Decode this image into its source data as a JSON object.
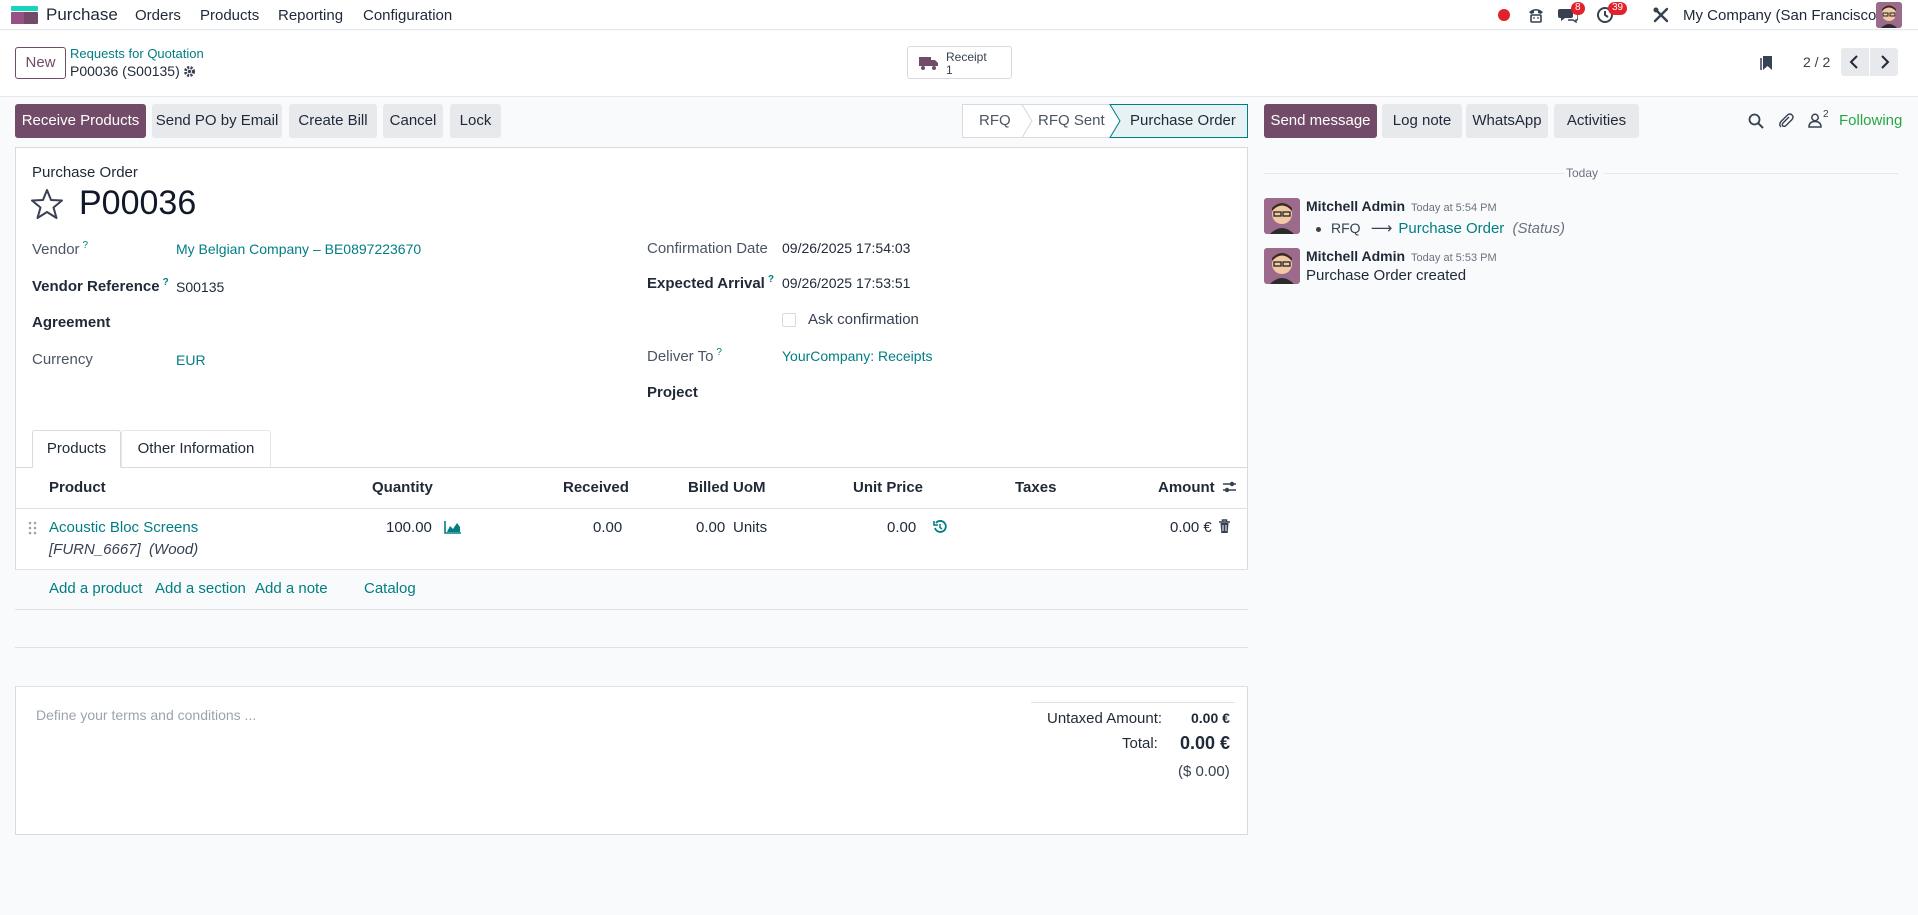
{
  "nav": {
    "app_name": "Purchase",
    "menus": [
      "Orders",
      "Products",
      "Reporting",
      "Configuration"
    ],
    "chat_badge": "8",
    "activity_badge": "39",
    "company": "My Company (San Francisco)"
  },
  "control": {
    "new_label": "New",
    "breadcrumb_parent": "Requests for Quotation",
    "record_name": "P00036 (S00135)",
    "smart_button_label": "Receipt",
    "smart_button_count": "1",
    "pager": "2 / 2"
  },
  "actions": {
    "receive_products": "Receive Products",
    "send_po_email": "Send PO by Email",
    "create_bill": "Create Bill",
    "cancel": "Cancel",
    "lock": "Lock"
  },
  "statusbar": {
    "stages": [
      "RFQ",
      "RFQ Sent",
      "Purchase Order"
    ],
    "active": "Purchase Order"
  },
  "form": {
    "kind": "Purchase Order",
    "name": "P00036",
    "vendor_label": "Vendor",
    "vendor_value": "My Belgian Company – BE0897223670",
    "vendor_ref_label": "Vendor Reference",
    "vendor_ref_value": "S00135",
    "agreement_label": "Agreement",
    "currency_label": "Currency",
    "currency_value": "EUR",
    "confirmation_date_label": "Confirmation Date",
    "confirmation_date_value": "09/26/2025 17:54:03",
    "expected_arrival_label": "Expected Arrival",
    "expected_arrival_value": "09/26/2025 17:53:51",
    "ask_confirmation_label": "Ask confirmation",
    "deliver_to_label": "Deliver To",
    "deliver_to_value": "YourCompany: Receipts",
    "project_label": "Project",
    "help_mark": "?"
  },
  "tabs": [
    "Products",
    "Other Information"
  ],
  "table": {
    "headers": {
      "product": "Product",
      "quantity": "Quantity",
      "received": "Received",
      "billed": "Billed",
      "uom": "UoM",
      "unit_price": "Unit Price",
      "taxes": "Taxes",
      "amount": "Amount"
    },
    "rows": [
      {
        "product": "Acoustic Bloc Screens",
        "description": "[FURN_6667]  (Wood)",
        "quantity": "100.00",
        "received": "0.00",
        "billed": "0.00",
        "uom": "Units",
        "unit_price": "0.00",
        "taxes": "",
        "amount": "0.00 €"
      }
    ],
    "add_product": "Add a product",
    "add_section": "Add a section",
    "add_note": "Add a note",
    "catalog": "Catalog"
  },
  "footer": {
    "terms_placeholder": "Define your terms and conditions ...",
    "untaxed_label": "Untaxed Amount:",
    "untaxed_value": "0.00 €",
    "total_label": "Total:",
    "total_value": "0.00 €",
    "total_usd": "($ 0.00)"
  },
  "chatter": {
    "send_message": "Send message",
    "log_note": "Log note",
    "whatsapp": "WhatsApp",
    "activities": "Activities",
    "followers_count": "2",
    "following": "Following",
    "date_separator": "Today",
    "messages": [
      {
        "author": "Mitchell Admin",
        "time": "Today at 5:54 PM",
        "from": "RFQ",
        "arrow": "⟶",
        "to": "Purchase Order",
        "field": "(Status)"
      },
      {
        "author": "Mitchell Admin",
        "time": "Today at 5:53 PM",
        "body": "Purchase Order created"
      }
    ]
  },
  "colors": {
    "primary": "#714b67",
    "link": "#017e84",
    "badge": "#e1222b",
    "following": "#28a745"
  }
}
